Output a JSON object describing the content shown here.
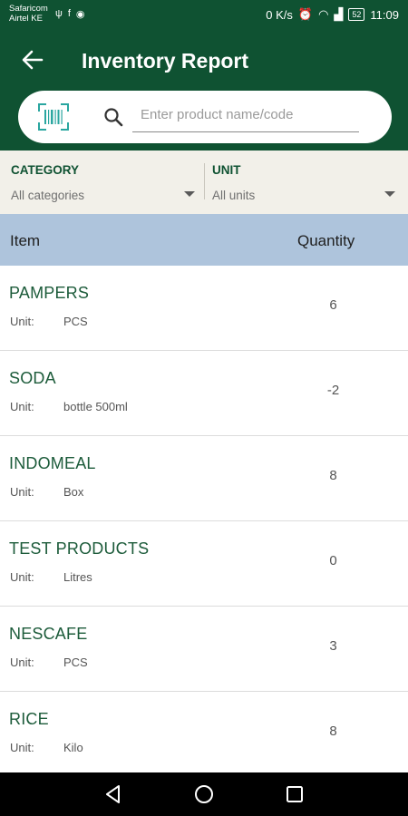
{
  "status_bar": {
    "carrier_line1": "Safaricom",
    "carrier_line2": "Airtel KE",
    "network_speed": "0 K/s",
    "battery": "52",
    "time": "11:09"
  },
  "app_bar": {
    "title": "Inventory Report",
    "back_icon": "arrow-left-icon"
  },
  "search": {
    "barcode_icon": "barcode-scan-icon",
    "search_icon": "search-icon",
    "placeholder": "Enter product name/code",
    "value": ""
  },
  "filters": {
    "category": {
      "label": "CATEGORY",
      "value": "All categories"
    },
    "unit": {
      "label": "UNIT",
      "value": "All units"
    }
  },
  "table": {
    "headers": {
      "item": "Item",
      "quantity": "Quantity"
    },
    "unit_label": "Unit:",
    "rows": [
      {
        "name": "PAMPERS",
        "unit": "PCS",
        "quantity": "6"
      },
      {
        "name": "SODA",
        "unit": "bottle 500ml",
        "quantity": "-2"
      },
      {
        "name": "INDOMEAL",
        "unit": "Box",
        "quantity": "8"
      },
      {
        "name": "TEST PRODUCTS",
        "unit": "Litres",
        "quantity": "0"
      },
      {
        "name": "NESCAFE",
        "unit": "PCS",
        "quantity": "3"
      },
      {
        "name": "RICE",
        "unit": "Kilo",
        "quantity": "8"
      }
    ]
  },
  "colors": {
    "primary": "#0f5232",
    "accent_teal": "#2aa6a0",
    "header_row": "#aec4dc",
    "filter_bg": "#f2f0e9"
  }
}
